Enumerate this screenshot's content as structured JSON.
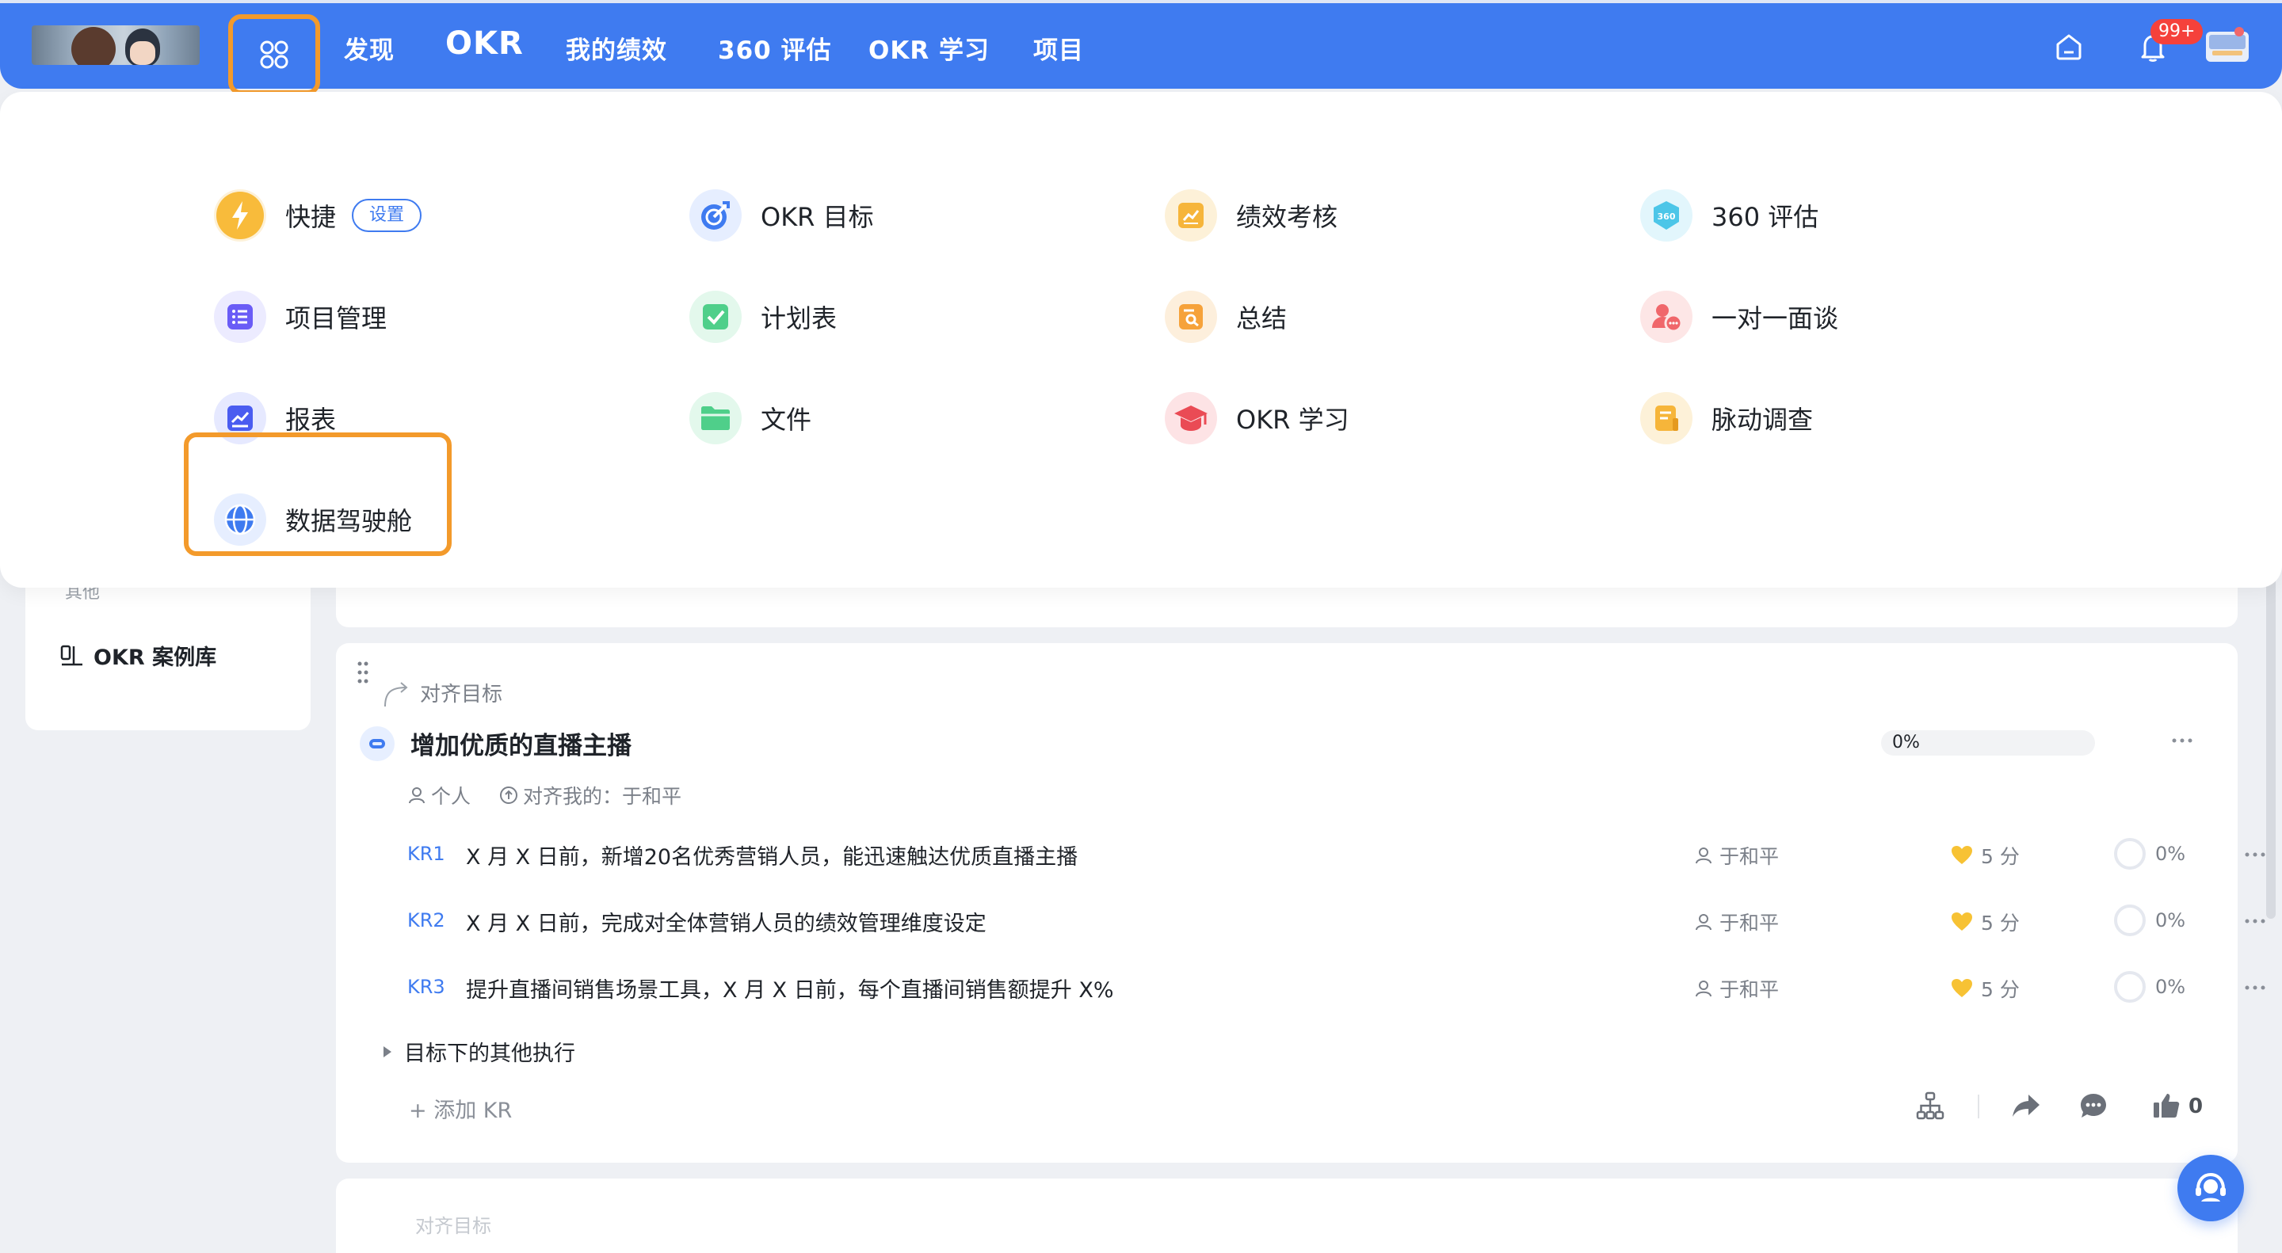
{
  "nav": {
    "items": [
      "发现",
      "OKR",
      "我的绩效",
      "360 评估",
      "OKR 学习",
      "项目"
    ],
    "notification_badge": "99+"
  },
  "menu": {
    "items": [
      {
        "label": "快捷",
        "icon": "lightning-icon",
        "color": "#f6b53a",
        "tag": "设置"
      },
      {
        "label": "OKR 目标",
        "icon": "target-icon",
        "color": "#3f7bf0"
      },
      {
        "label": "绩效考核",
        "icon": "performance-chart-icon",
        "color": "#f6b53a"
      },
      {
        "label": "360 评估",
        "icon": "360-badge-icon",
        "color": "#4cc6e8"
      },
      {
        "label": "项目管理",
        "icon": "list-icon",
        "color": "#6a5cf6"
      },
      {
        "label": "计划表",
        "icon": "checkbox-icon",
        "color": "#4fcf8a"
      },
      {
        "label": "总结",
        "icon": "summary-search-icon",
        "color": "#f6a23a"
      },
      {
        "label": "一对一面谈",
        "icon": "chat-person-icon",
        "color": "#f0676b"
      },
      {
        "label": "报表",
        "icon": "report-chart-icon",
        "color": "#4a5cf0"
      },
      {
        "label": "文件",
        "icon": "folder-icon",
        "color": "#4fcf8a"
      },
      {
        "label": "OKR 学习",
        "icon": "graduation-cap-icon",
        "color": "#ea4b55"
      },
      {
        "label": "脉动调查",
        "icon": "survey-icon",
        "color": "#f6b53a"
      },
      {
        "label": "数据驾驶舱",
        "icon": "globe-icon",
        "color": "#3f7bf0"
      }
    ]
  },
  "sidebar": {
    "section": "其他",
    "case_library": "OKR 案例库"
  },
  "objective": {
    "align_label": "对齐目标",
    "title": "增加优质的直播主播",
    "progress": "0%",
    "type": "个人",
    "aligned_with": "对齐我的：于和平",
    "krs": [
      {
        "code": "KR1",
        "text": "X 月 X 日前，新增20名优秀营销人员，能迅速触达优质直播主播",
        "owner": "于和平",
        "score": "5 分",
        "progress": "0%"
      },
      {
        "code": "KR2",
        "text": "X 月 X 日前，完成对全体营销人员的绩效管理维度设定",
        "owner": "于和平",
        "score": "5 分",
        "progress": "0%"
      },
      {
        "code": "KR3",
        "text": "提升直播间销售场景工具，X 月 X 日前，每个直播间销售额提升 X%",
        "owner": "于和平",
        "score": "5 分",
        "progress": "0%"
      }
    ],
    "other_exec": "目标下的其他执行",
    "add_kr": "+ 添加 KR",
    "like_count": "0"
  },
  "next_card_peek": "对齐目标"
}
